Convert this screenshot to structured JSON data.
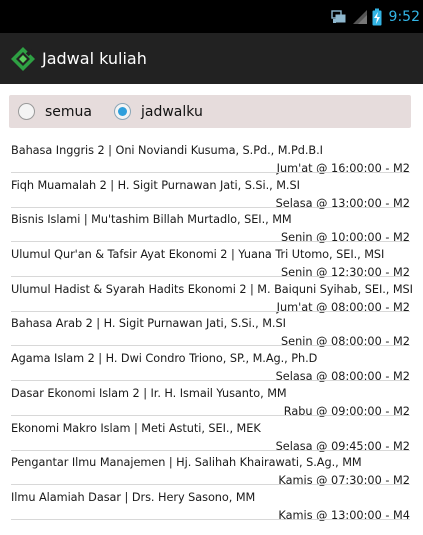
{
  "statusbar": {
    "time": "9:52",
    "icons": [
      "sync-icon",
      "signal-icon",
      "battery-icon"
    ]
  },
  "actionbar": {
    "title": "Jadwal kuliah",
    "logo_icon": "app-logo-icon"
  },
  "filter": {
    "options": [
      {
        "label": "semua",
        "checked": false
      },
      {
        "label": "jadwalku",
        "checked": true
      }
    ]
  },
  "schedule": [
    {
      "title": "Bahasa Inggris 2 | Oni Noviandi Kusuma, S.Pd., M.Pd.B.I",
      "time": "Jum'at @ 16:00:00 - M2"
    },
    {
      "title": "Fiqh Muamalah 2 | H. Sigit Purnawan Jati, S.Si., M.SI",
      "time": "Selasa @ 13:00:00 - M2"
    },
    {
      "title": "Bisnis Islami  | Mu'tashim Billah Murtadlo, SEI., MM",
      "time": "Senin @ 10:00:00 - M2"
    },
    {
      "title": "Ulumul Qur'an & Tafsir Ayat Ekonomi 2 | Yuana Tri Utomo, SEI., MSI",
      "time": "Senin @ 12:30:00 - M2"
    },
    {
      "title": "Ulumul Hadist & Syarah Hadits Ekonomi 2 | M. Baiquni Syihab, SEI., MSI",
      "time": "Jum'at @ 08:00:00 - M2"
    },
    {
      "title": "Bahasa Arab 2 | H. Sigit Purnawan Jati, S.Si., M.SI",
      "time": "Senin @ 08:00:00 - M2"
    },
    {
      "title": "Agama Islam 2 | H. Dwi Condro Triono, SP., M.Ag., Ph.D",
      "time": "Selasa @ 08:00:00 - M2"
    },
    {
      "title": "Dasar Ekonomi Islam 2 | Ir. H. Ismail Yusanto, MM",
      "time": "Rabu @ 09:00:00 - M2"
    },
    {
      "title": "Ekonomi Makro Islam | Meti Astuti, SEI., MEK",
      "time": "Selasa @ 09:45:00 - M2"
    },
    {
      "title": "Pengantar Ilmu Manajemen | Hj. Salihah Khairawati, S.Ag., MM",
      "time": "Kamis @ 07:30:00 - M2"
    },
    {
      "title": "Ilmu Alamiah Dasar | Drs. Hery Sasono, MM",
      "time": "Kamis @ 13:00:00 - M4"
    }
  ]
}
